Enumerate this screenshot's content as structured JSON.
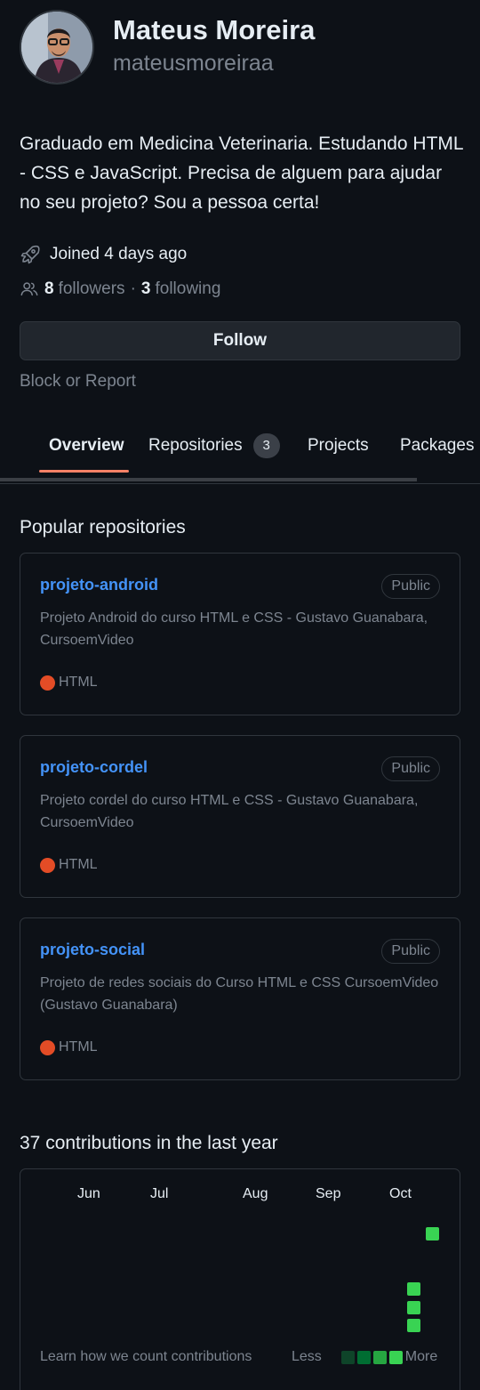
{
  "profile": {
    "name": "Mateus Moreira",
    "login": "mateusmoreiraa",
    "bio": "Graduado em Medicina Veterinaria. Estudando HTML - CSS e JavaScript. Precisa de alguem para ajudar no seu projeto? Sou a pessoa certa!",
    "joined": "Joined 4 days ago",
    "followers_count": "8",
    "followers_label": "followers",
    "separator": "·",
    "following_count": "3",
    "following_label": "following",
    "follow_button": "Follow",
    "block_report": "Block or Report"
  },
  "tabs": [
    {
      "label": "Overview",
      "active": true
    },
    {
      "label": "Repositories",
      "counter": "3"
    },
    {
      "label": "Projects"
    },
    {
      "label": "Packages"
    }
  ],
  "popular": {
    "title": "Popular repositories",
    "repos": [
      {
        "name": "projeto-android",
        "visibility": "Public",
        "description": "Projeto Android do curso HTML e CSS - Gustavo Guanabara, CursoemVideo",
        "language": "HTML",
        "language_color": "#e34c26"
      },
      {
        "name": "projeto-cordel",
        "visibility": "Public",
        "description": "Projeto cordel do curso HTML e CSS - Gustavo Guanabara, CursoemVideo",
        "language": "HTML",
        "language_color": "#e34c26"
      },
      {
        "name": "projeto-social",
        "visibility": "Public",
        "description": "Projeto de redes sociais do Curso HTML e CSS CursoemVideo (Gustavo Guanabara)",
        "language": "HTML",
        "language_color": "#e34c26"
      }
    ]
  },
  "contributions": {
    "title": "37 contributions in the last year",
    "months": [
      "Jun",
      "Jul",
      "Aug",
      "Sep",
      "Oct"
    ],
    "learn_link": "Learn how we count contributions",
    "legend_less": "Less",
    "legend_more": "More",
    "legend_colors": [
      "#0e4429",
      "#006d32",
      "#26a641",
      "#39d353"
    ],
    "active_color": "#39d353"
  },
  "colors": {
    "background": "#0d1117",
    "border": "#30363d",
    "link": "#4493f8",
    "muted": "#7d8590",
    "tab_underline": "#f78166"
  }
}
